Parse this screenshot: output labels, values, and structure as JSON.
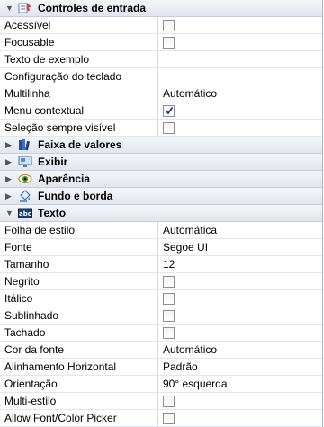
{
  "categories": {
    "input": "Controles de entrada",
    "range": "Faixa de valores",
    "display": "Exibir",
    "appearance": "Aparência",
    "background": "Fundo e borda",
    "text": "Texto"
  },
  "input_rows": [
    {
      "name": "Acessível",
      "checked": false
    },
    {
      "name": "Focusable",
      "checked": false
    },
    {
      "name": "Texto de exemplo",
      "value": ""
    },
    {
      "name": "Configuração do teclado",
      "value": ""
    },
    {
      "name": "Multilinha",
      "value": "Automático"
    },
    {
      "name": "Menu contextual",
      "checked": true
    },
    {
      "name": "Seleção sempre visível",
      "checked": false
    }
  ],
  "text_rows": [
    {
      "name": "Folha de estilo",
      "value": "Automática"
    },
    {
      "name": "Fonte",
      "value": "Segoe UI"
    },
    {
      "name": "Tamanho",
      "value": "12"
    },
    {
      "name": "Negrito",
      "checked": false
    },
    {
      "name": "Itálico",
      "checked": false
    },
    {
      "name": "Sublinhado",
      "checked": false
    },
    {
      "name": "Tachado",
      "checked": false
    },
    {
      "name": "Cor da fonte",
      "value": "Automático"
    },
    {
      "name": "Alinhamento Horizontal",
      "value": "Padrão"
    },
    {
      "name": "Orientação",
      "value": "90° esquerda"
    },
    {
      "name": "Multi-estilo",
      "checked": false
    },
    {
      "name": "Allow Font/Color Picker",
      "checked": false
    }
  ],
  "icons": {
    "input": "form-controls-icon",
    "range": "books-icon",
    "display": "display-icon",
    "appearance": "eye-icon",
    "background": "paint-bucket-icon",
    "text": "text-abc-icon"
  }
}
